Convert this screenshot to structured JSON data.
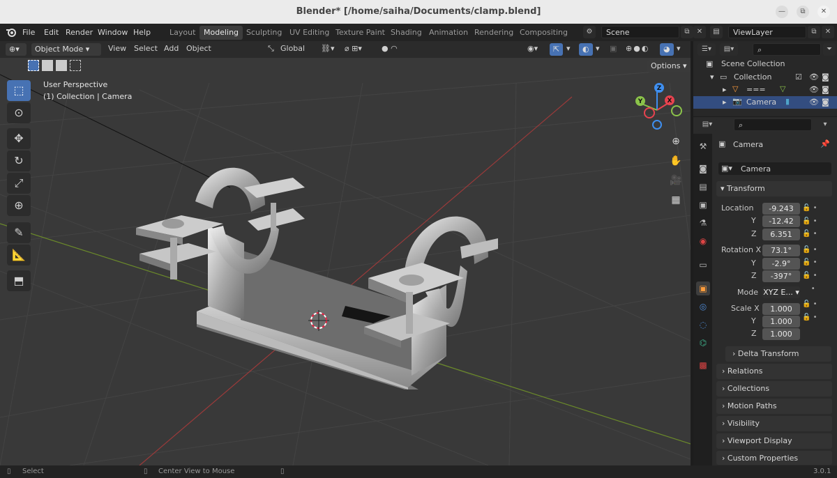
{
  "window": {
    "title": "Blender* [/home/saiha/Documents/clamp.blend]",
    "min": "—",
    "max": "⧉",
    "close": "✕"
  },
  "menus": [
    "File",
    "Edit",
    "Render",
    "Window",
    "Help"
  ],
  "workspaces": [
    "Layout",
    "Modeling",
    "Sculpting",
    "UV Editing",
    "Texture Paint",
    "Shading",
    "Animation",
    "Rendering",
    "Compositing"
  ],
  "active_workspace": "Modeling",
  "scene": {
    "label": "Scene"
  },
  "viewlayer": {
    "label": "ViewLayer"
  },
  "viewport": {
    "mode": "Object Mode",
    "menus": [
      "View",
      "Select",
      "Add",
      "Object"
    ],
    "orientation": "Global",
    "options": "Options",
    "perspective": "User Perspective",
    "collection_info": "(1) Collection | Camera"
  },
  "gizmo": {
    "x": "X",
    "y": "Y",
    "z": "Z"
  },
  "outliner": {
    "scene_collection": "Scene Collection",
    "collection": "Collection",
    "items": [
      "===",
      "Camera"
    ]
  },
  "properties": {
    "object_name": "Camera",
    "object_field": "Camera",
    "transform": "Transform",
    "location_label": "Location",
    "rotation_label": "Rotation X",
    "scale_label": "Scale X",
    "mode_label": "Mode",
    "mode_value": "XYZ E...",
    "axis_y": "Y",
    "axis_z": "Z",
    "location": [
      "-9.243",
      "-12.42",
      "6.351"
    ],
    "rotation": [
      "73.1°",
      "-2.9°",
      "-397°"
    ],
    "scale": [
      "1.000",
      "1.000",
      "1.000"
    ],
    "delta": "Delta Transform",
    "panels": [
      "Relations",
      "Collections",
      "Motion Paths",
      "Visibility",
      "Viewport Display",
      "Custom Properties"
    ]
  },
  "status": {
    "select": "Select",
    "center": "Center View to Mouse",
    "version": "3.0.1"
  },
  "colors": {
    "accent": "#4772b3",
    "selection": "#334d80",
    "x_axis": "#e8434f",
    "y_axis": "#8bc34a",
    "z_axis": "#3f8ff0"
  }
}
